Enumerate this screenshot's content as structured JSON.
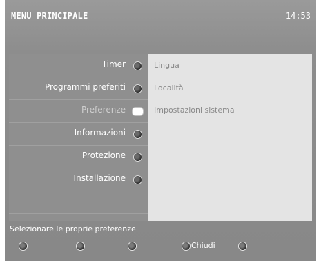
{
  "header": {
    "title": "MENU PRINCIPALE",
    "time": "14:53"
  },
  "menu": {
    "items": [
      {
        "label": "Timer",
        "icon": "radio-button-icon"
      },
      {
        "label": "Programmi preferiti",
        "icon": "radio-button-icon"
      },
      {
        "label": "Preferenze",
        "icon": "selected-pointer-icon",
        "selected": true
      },
      {
        "label": "Informazioni",
        "icon": "radio-button-icon"
      },
      {
        "label": "Protezione",
        "icon": "radio-button-icon"
      },
      {
        "label": "Installazione",
        "icon": "radio-button-icon"
      }
    ]
  },
  "submenu": {
    "items": [
      {
        "label": "Lingua"
      },
      {
        "label": "Località"
      },
      {
        "label": "Impostazioni sistema"
      }
    ]
  },
  "hint": "Selezionare le proprie preferenze",
  "footer": {
    "buttons": [
      {
        "label": "",
        "icon": "red-key-icon"
      },
      {
        "label": "",
        "icon": "green-key-icon"
      },
      {
        "label": "",
        "icon": "yellow-key-icon"
      },
      {
        "label": "Chiudi",
        "icon": "blue-key-icon"
      },
      {
        "label": "",
        "icon": "white-key-icon"
      }
    ]
  }
}
